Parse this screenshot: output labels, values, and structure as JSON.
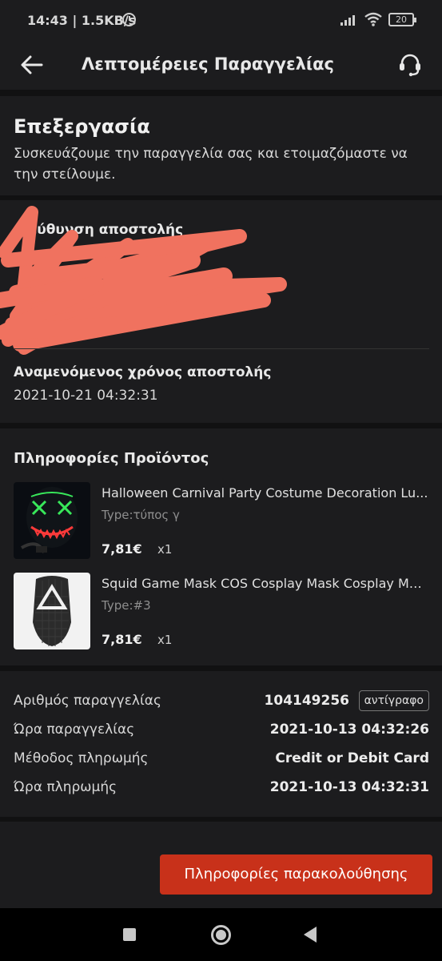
{
  "status_bar": {
    "time": "14:43 | 1.5KB/s",
    "battery": "20"
  },
  "header": {
    "title": "Λεπτομέρειες Παραγγελίας"
  },
  "order_status": {
    "heading": "Επεξεργασία",
    "description": "Συσκευάζουμε την παραγγελία σας και ετοιμαζόμαστε να την στείλουμε."
  },
  "shipping": {
    "address_label": "Διεύθυνση αποστολής",
    "estimated_label": "Αναμενόμενος χρόνος αποστολής",
    "estimated_value": "2021-10-21 04:32:31",
    "redaction_color": "#f0725f"
  },
  "products": {
    "title": "Πληροφορίες Προϊόντος",
    "items": [
      {
        "name": "Halloween Carnival Party Costume Decoration Lu...",
        "type": "Type:τύπος γ",
        "price": "7,81€",
        "qty": "x1"
      },
      {
        "name": "Squid Game Mask COS Cosplay Mask Cosplay Mas...",
        "type": "Type:#3",
        "price": "7,81€",
        "qty": "x1"
      }
    ]
  },
  "order_info": {
    "order_number_label": "Αριθμός παραγγελίας",
    "order_number": "104149256",
    "copy_label": "αντίγραφο",
    "order_time_label": "Ώρα παραγγελίας",
    "order_time": "2021-10-13 04:32:26",
    "payment_method_label": "Μέθοδος πληρωμής",
    "payment_method": "Credit or Debit Card",
    "payment_time_label": "Ώρα πληρωμής",
    "payment_time": "2021-10-13 04:32:31"
  },
  "actions": {
    "tracking_button": "Πληροφορίες παρακολούθησης",
    "accent_color": "#c8311a"
  }
}
